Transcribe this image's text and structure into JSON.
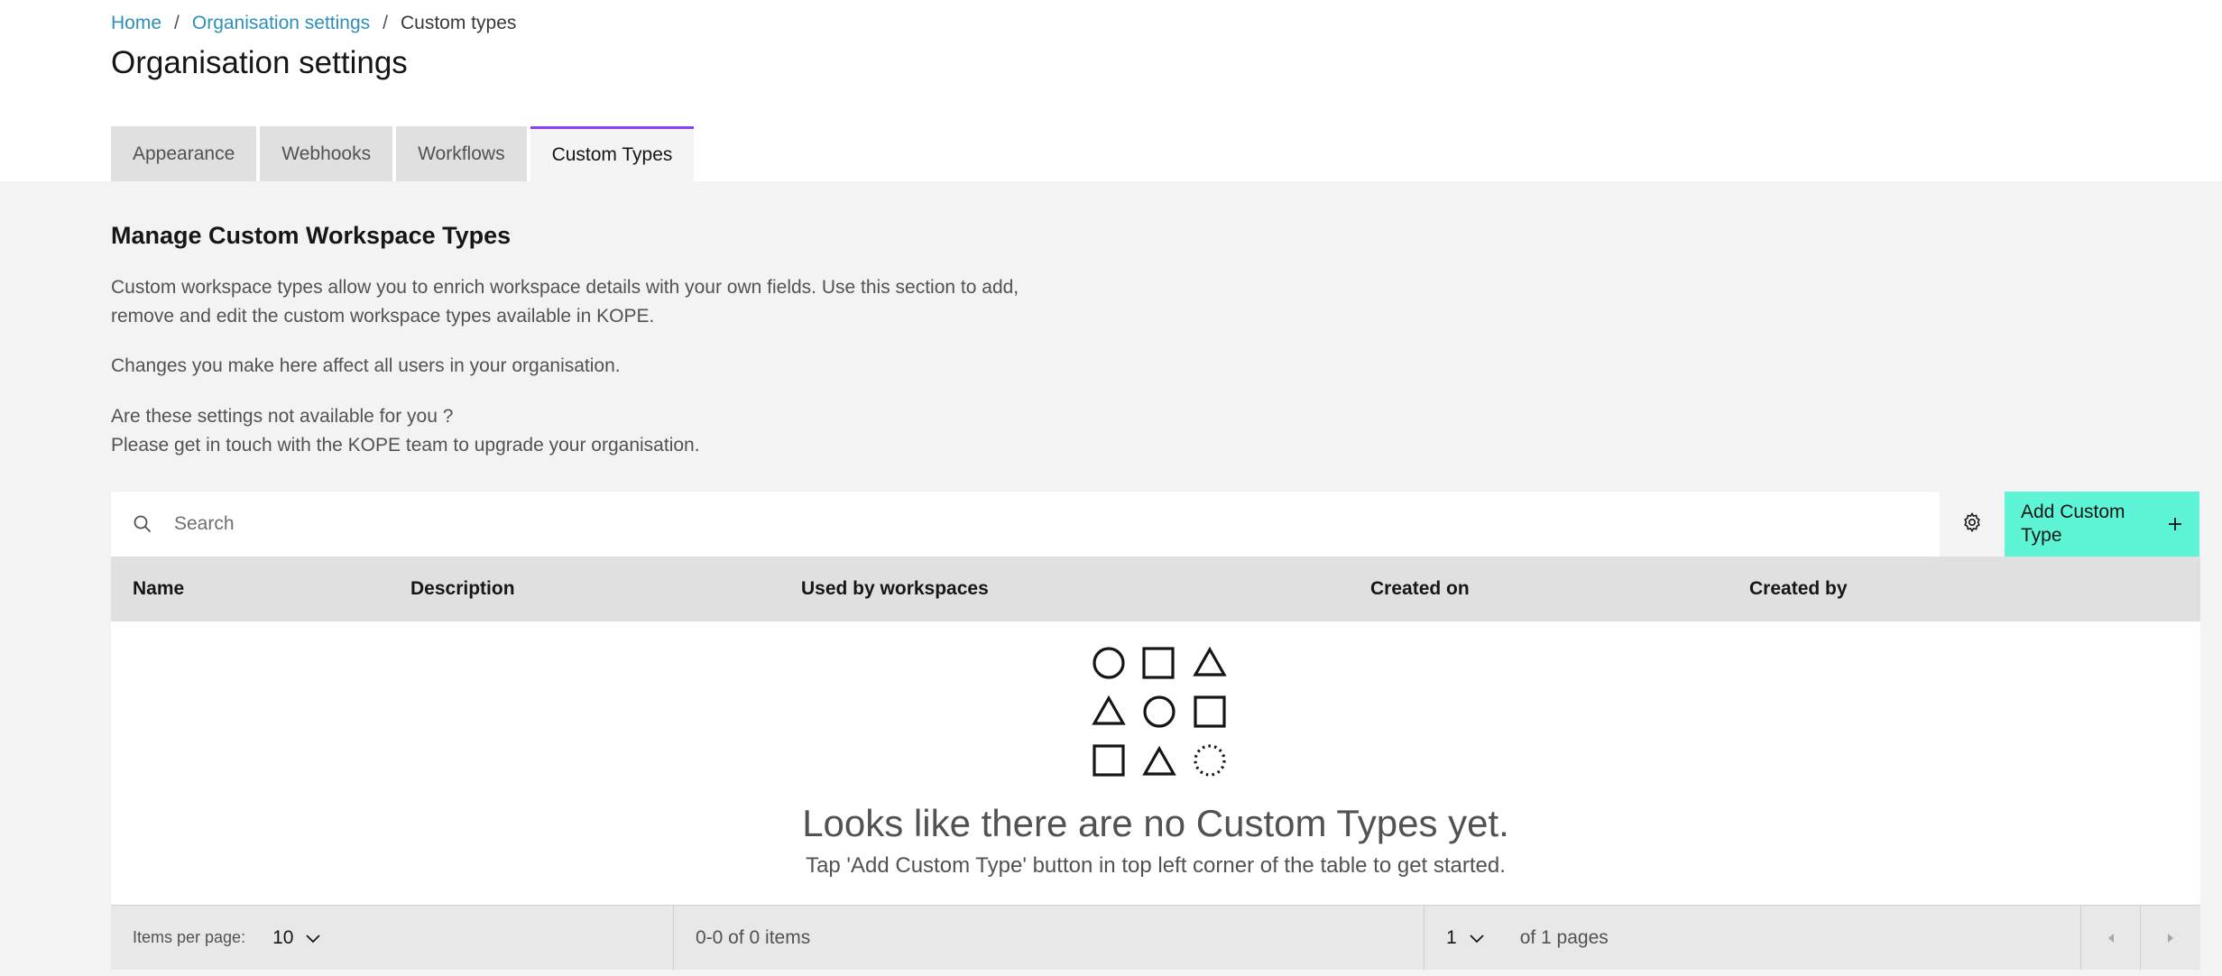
{
  "breadcrumb": {
    "home": "Home",
    "sep1": "/",
    "org": "Organisation settings",
    "sep2": "/",
    "current": "Custom types"
  },
  "page_title": "Organisation settings",
  "tabs": [
    {
      "label": "Appearance",
      "active": false
    },
    {
      "label": "Webhooks",
      "active": false
    },
    {
      "label": "Workflows",
      "active": false
    },
    {
      "label": "Custom Types",
      "active": true
    }
  ],
  "section": {
    "title": "Manage Custom Workspace Types",
    "para1": "Custom workspace types allow you to enrich workspace details with your own fields. Use this section to add, remove and edit the custom workspace types available in KOPE.",
    "para2": "Changes you make here affect all users in your organisation.",
    "para3_line1": "Are these settings not available for you ?",
    "para3_line2": "Please get in touch with the KOPE team to upgrade your organisation."
  },
  "toolbar": {
    "search_placeholder": "Search",
    "search_value": "",
    "add_label": "Add Custom Type",
    "icons": {
      "search": "search-icon",
      "settings": "gear-icon",
      "add": "plus-icon"
    },
    "accent_color": "#5ef5d6"
  },
  "table": {
    "columns": [
      "Name",
      "Description",
      "Used by workspaces",
      "Created on",
      "Created by"
    ],
    "rows": []
  },
  "empty_state": {
    "title": "Looks like there are no Custom Types yet.",
    "subtitle": "Tap 'Add Custom Type' button in top left corner of the table to get started.",
    "icon": "shapes-grid-icon"
  },
  "pagination": {
    "items_per_page_label": "Items per page:",
    "items_per_page": "10",
    "range_text": "0-0 of 0 items",
    "current_page": "1",
    "total_pages_text": "of 1 pages"
  },
  "colors": {
    "link": "#2e8fb8",
    "active_tab_border": "#8a3ffc",
    "background": "#f3f3f3"
  }
}
